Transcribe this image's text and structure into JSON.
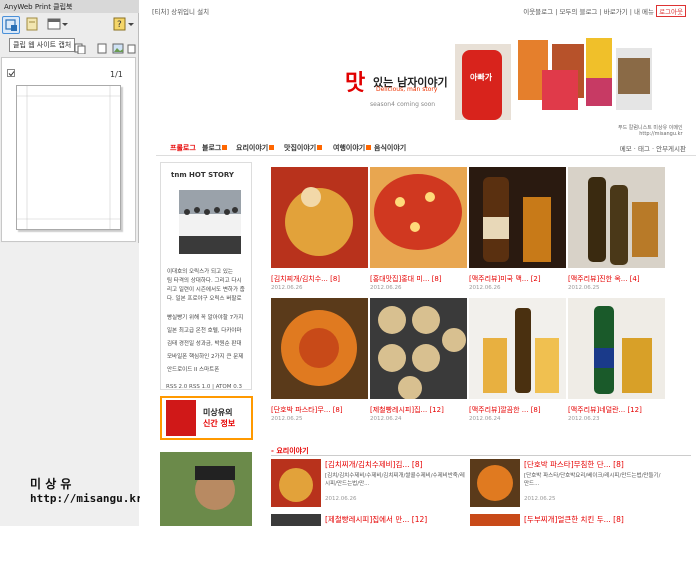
{
  "sidebar": {
    "title": "AnyWeb Print 클립북",
    "tooltip": "클립 웹 사이트 캡처",
    "page_indicator": "1/1",
    "footer_name": "미 상 유",
    "footer_url": "http://misangu.kr"
  },
  "blog": {
    "top_left": "[티처] 상위입니 설치",
    "top_right_links": [
      "이웃블로그",
      "모두의 블로그",
      "바로가기",
      "내 메뉴"
    ],
    "logout": "로그아웃",
    "logo_mat": "맛",
    "logo_text": "있는 남자이야기",
    "logo_sub": "Delicious, man story",
    "logo_season": "season4 coming soon",
    "banner_book_title": "아빠가 차려주는 밥상",
    "banner_credit1": "푸드 칼럼니스트 미상유 이메인",
    "banner_credit2": "http://misangu.kr",
    "nav": [
      "프롤로그",
      "블로그",
      "요리이야기",
      "맛집이야기",
      "여행이야기",
      "음식이야기"
    ],
    "nav_right": "메모 · 태그 · 안부게시판",
    "tnm_header": "tnm  HOT STORY",
    "tnm_lines": [
      "이대호의 오릭스가 되고 있는",
      "팀 타격의 상대하다. 그리고 다시",
      "리고 일련이 시즌에서도 변하가 줍",
      "다. 일본 프로야구 오릭스 버팔로",
      "빵실빵기 위해 꼭 알아야할 7가지",
      "일본 최고급 온천 호텔, 다카야마",
      "김태 경전일 성과금, 박원순 판대",
      "모바일폰 핵심하인 2가지 큰 문제",
      "안드로이드 II 스마트폰"
    ],
    "rss": "RSS 2.0  RSS 1.0 | ATOM 0.3",
    "ad_line1": "미상유의",
    "ad_line2": "신간 정보",
    "cards": [
      {
        "title": "[김치찌개/김치수...",
        "count": "[8]",
        "date": "2012.06.26"
      },
      {
        "title": "[홍대맛집]홍대 미...",
        "count": "[8]",
        "date": "2012.06.26"
      },
      {
        "title": "[맥주리뷰]미국 맥...",
        "count": "[2]",
        "date": "2012.06.26"
      },
      {
        "title": "[맥주리뷰]진한 옥...",
        "count": "[4]",
        "date": "2012.06.25"
      },
      {
        "title": "[단호박 파스타]무...",
        "count": "[8]",
        "date": "2012.06.25"
      },
      {
        "title": "[제철빵레시피]집...",
        "count": "[12]",
        "date": "2012.06.24"
      },
      {
        "title": "[맥주리뷰]깔끔한 ...",
        "count": "[8]",
        "date": "2012.06.24"
      },
      {
        "title": "[맥주리뷰]네덜란...",
        "count": "[12]",
        "date": "2012.06.23"
      }
    ],
    "section_title": "- 요리이야기",
    "list": [
      {
        "title": "[김치찌개/김치수제비]김...",
        "count": "[8]",
        "body": "[김치/김치수제비/수제비/김치찌개/쌀콜수제비/수제비반죽/레시피/만드는법/만...",
        "date": "2012.06.26"
      },
      {
        "title": "[단호박 파스타]무침한 단...",
        "count": "[8]",
        "body": "[단호박 파스타/단호박요리/베이크/레시피/만드는법/만들기/만드...",
        "date": "2012.06.25"
      },
      {
        "title": "[제철빵레시피]집에서 만...",
        "count": "[12]"
      },
      {
        "title": "[두부찌개]얼큰한 치킨 두...",
        "count": "[8]"
      }
    ]
  }
}
